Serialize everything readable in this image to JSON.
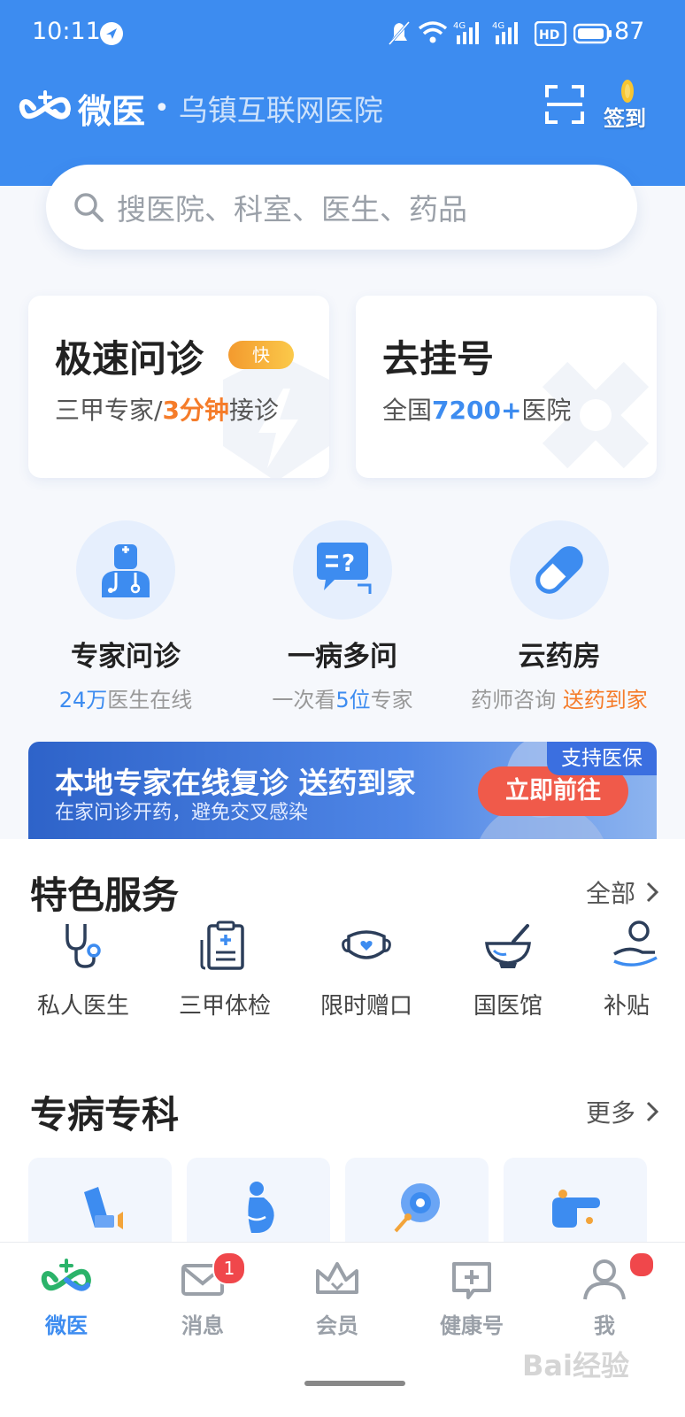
{
  "status_bar": {
    "time": "10:11",
    "battery": "87"
  },
  "header": {
    "brand": "微医",
    "separator": "•",
    "hospital": "乌镇互联网医院",
    "checkin_label": "签到"
  },
  "search": {
    "placeholder": "搜医院、科室、医生、药品"
  },
  "cards": [
    {
      "title": "极速问诊",
      "badge": "快",
      "sub_pre": "三甲专家/",
      "sub_hl": "3分钟",
      "sub_post": "接诊"
    },
    {
      "title": "去挂号",
      "sub_pre": "全国",
      "sub_hl": "7200+",
      "sub_post": "医院"
    }
  ],
  "quick_services": [
    {
      "title": "专家问诊",
      "sub_hl": "24万",
      "sub_post": "医生在线",
      "icon": "doctor-icon"
    },
    {
      "title": "一病多问",
      "sub_pre": "一次看",
      "sub_hl": "5位",
      "sub_post": "专家",
      "icon": "question-chat-icon"
    },
    {
      "title": "云药房",
      "sub_pre": "药师咨询 ",
      "sub_hl": "送药到家",
      "icon": "pill-icon"
    }
  ],
  "banner": {
    "title": "本地专家在线复诊 送药到家",
    "subtitle": "在家问诊开药，避免交叉感染",
    "button": "立即前往",
    "tag": "支持医保"
  },
  "featured": {
    "title": "特色服务",
    "more": "全部",
    "items": [
      {
        "label": "私人医生",
        "icon": "stethoscope-icon"
      },
      {
        "label": "三甲体检",
        "icon": "medical-report-icon"
      },
      {
        "label": "限时赠口",
        "icon": "mask-icon"
      },
      {
        "label": "国医馆",
        "icon": "mortar-icon"
      },
      {
        "label": "补贴",
        "icon": "subsidy-icon"
      }
    ]
  },
  "specialty": {
    "title": "专病专科",
    "more": "更多"
  },
  "nav": {
    "items": [
      {
        "label": "微医",
        "icon": "home-logo-icon",
        "active": true
      },
      {
        "label": "消息",
        "icon": "mail-icon",
        "badge": "1"
      },
      {
        "label": "会员",
        "icon": "crown-icon"
      },
      {
        "label": "健康号",
        "icon": "health-plus-icon"
      },
      {
        "label": "我",
        "icon": "profile-icon"
      }
    ]
  },
  "colors": {
    "primary": "#3d8cf0",
    "accent": "#f57c2a",
    "banner_button": "#f05a4a"
  },
  "watermark": "Bai经验"
}
